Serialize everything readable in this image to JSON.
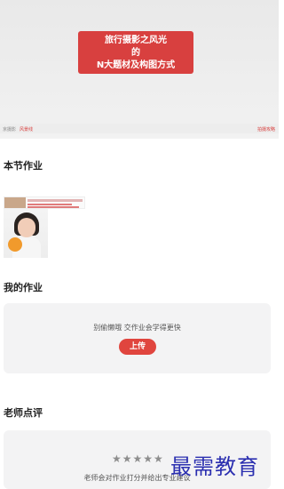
{
  "video": {
    "title_line1": "旅行摄影之风光",
    "title_line2": "的",
    "title_line3": "N大题材及构图方式",
    "bar_left": "京摄影",
    "bar_left_highlight": "风景线",
    "bar_right": "拍摄攻略"
  },
  "sections": {
    "lesson_homework": "本节作业",
    "my_homework": "我的作业",
    "teacher_review": "老师点评"
  },
  "my_homework_card": {
    "hint": "别偷懒哦 交作业会学得更快",
    "upload_label": "上传"
  },
  "teacher_review_card": {
    "stars": "★★★★★",
    "hint": "老师会对作业打分并给出专业建议"
  },
  "watermark": "最需教育",
  "colors": {
    "accent": "#e0453e",
    "card_bg": "#f3f3f4",
    "watermark": "#2b2fb0"
  }
}
